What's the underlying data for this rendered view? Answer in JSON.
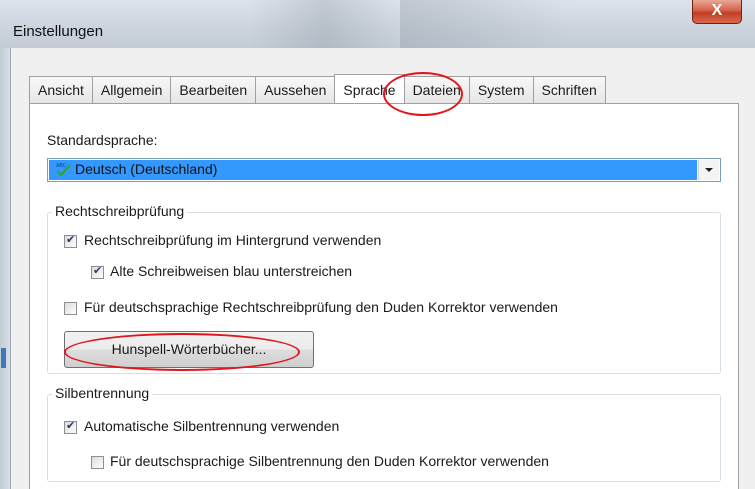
{
  "window": {
    "title": "Einstellungen",
    "close_glyph": "X"
  },
  "tabs": [
    {
      "label": "Ansicht",
      "active": false
    },
    {
      "label": "Allgemein",
      "active": false
    },
    {
      "label": "Bearbeiten",
      "active": false
    },
    {
      "label": "Aussehen",
      "active": false
    },
    {
      "label": "Sprache",
      "active": true
    },
    {
      "label": "Dateien",
      "active": false
    },
    {
      "label": "System",
      "active": false
    },
    {
      "label": "Schriften",
      "active": false
    }
  ],
  "default_language": {
    "label": "Standardsprache:",
    "value": "Deutsch (Deutschland)",
    "icon": "spellcheck-icon"
  },
  "spellcheck": {
    "group_title": "Rechtschreibprüfung",
    "background_check": {
      "label": "Rechtschreibprüfung im Hintergrund verwenden",
      "checked": true
    },
    "old_spellings": {
      "label": "Alte Schreibweisen blau unterstreichen",
      "checked": true
    },
    "duden": {
      "label": "Für deutschsprachige Rechtschreibprüfung den Duden Korrektor verwenden",
      "checked": false
    },
    "hunspell_button": "Hunspell-Wörterbücher..."
  },
  "hyphenation": {
    "group_title": "Silbentrennung",
    "auto": {
      "label": "Automatische Silbentrennung verwenden",
      "checked": true
    },
    "duden": {
      "label": "Für deutschsprachige Silbentrennung den Duden Korrektor verwenden",
      "checked": false
    }
  },
  "colors": {
    "selection": "#3399ff",
    "annotation": "#e0161b",
    "close_button": "#c23d22"
  }
}
